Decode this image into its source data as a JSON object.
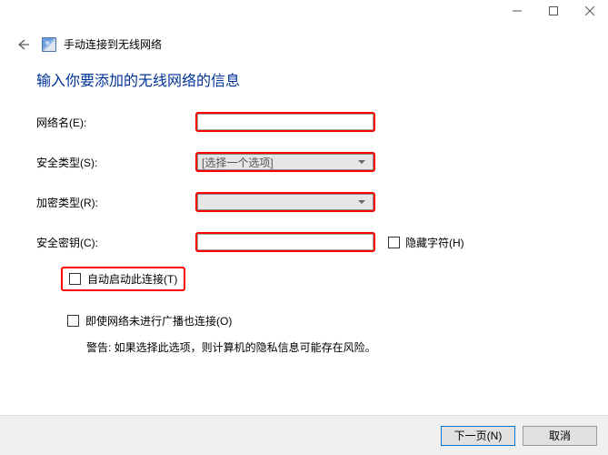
{
  "window": {
    "title": "手动连接到无线网络"
  },
  "heading": "输入你要添加的无线网络的信息",
  "labels": {
    "network_name": "网络名(E):",
    "security_type": "安全类型(S):",
    "encryption_type": "加密类型(R):",
    "security_key": "安全密钥(C):",
    "hide_chars": "隐藏字符(H)",
    "auto_start": "自动启动此连接(T)",
    "connect_hidden": "即使网络未进行广播也连接(O)"
  },
  "placeholders": {
    "security_type": "[选择一个选项]",
    "encryption_type": ""
  },
  "warning": "警告: 如果选择此选项，则计算机的隐私信息可能存在风险。",
  "buttons": {
    "next": "下一页(N)",
    "cancel": "取消"
  }
}
